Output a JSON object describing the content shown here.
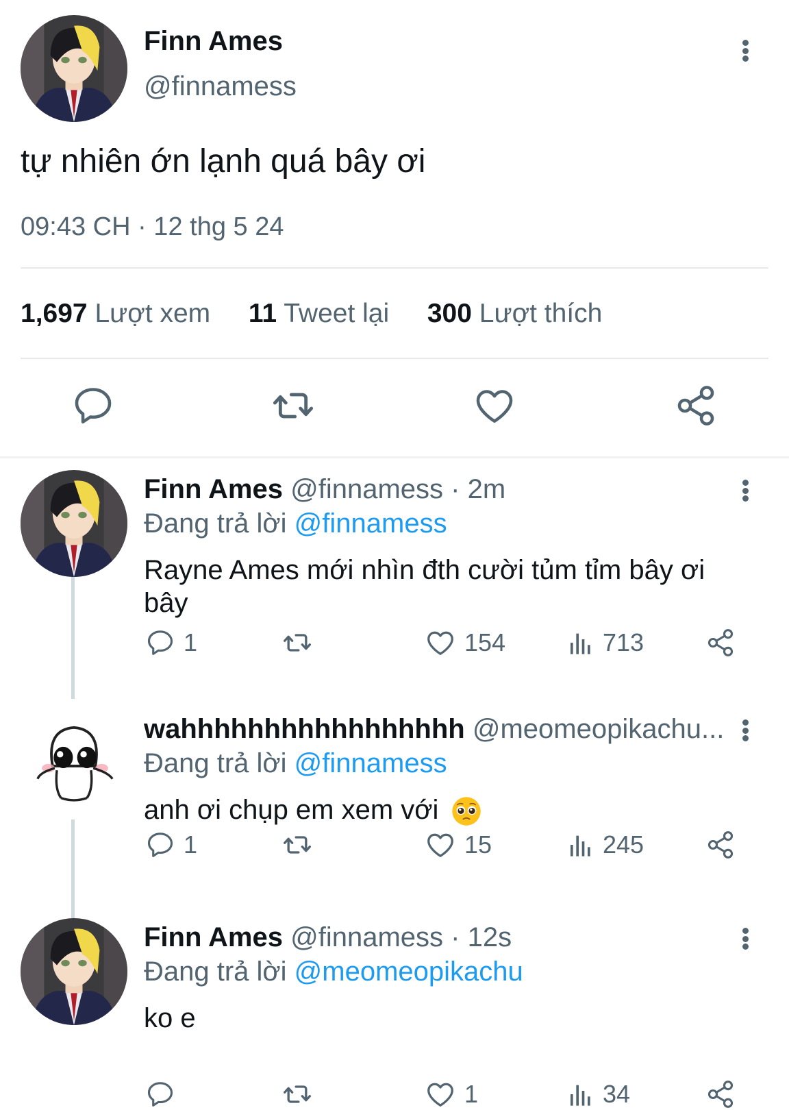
{
  "main_tweet": {
    "author_name": "Finn Ames",
    "author_handle": "@finnamess",
    "text": "tự nhiên ớn lạnh quá bây ơi",
    "timestamp": "09:43 CH · 12 thg 5 24",
    "stats": {
      "views_count": "1,697",
      "views_label": "Lượt xem",
      "retweets_count": "11",
      "retweets_label": "Tweet lại",
      "likes_count": "300",
      "likes_label": "Lượt thích"
    }
  },
  "replies": [
    {
      "author_name": "Finn Ames",
      "author_handle": "@finnamess",
      "time": "· 2m",
      "replying_prefix": "Đang trả lời",
      "replying_to": "@finnamess",
      "text": "Rayne Ames mới nhìn đth cười tủm tỉm bây ơi bây",
      "reply_count": "1",
      "like_count": "154",
      "view_count": "713"
    },
    {
      "author_name": "wahhhhhhhhhhhhhhhhh",
      "author_handle": "@meomeopikachu...",
      "replying_prefix": "Đang trả lời",
      "replying_to": "@finnamess",
      "text": "anh ơi chụp em xem với",
      "emoji": "pleading-face-emoji",
      "reply_count": "1",
      "like_count": "15",
      "view_count": "245"
    },
    {
      "author_name": "Finn Ames",
      "author_handle": "@finnamess",
      "time": "· 12s",
      "replying_prefix": "Đang trả lời",
      "replying_to": "@meomeopikachu",
      "text": "ko e",
      "reply_count": "",
      "like_count": "1",
      "view_count": "34"
    }
  ],
  "colors": {
    "text_primary": "#0f1419",
    "text_secondary": "#536471",
    "mention_blue": "#1d9bf0",
    "divider": "#e6e8ea",
    "thread_line": "#cfd9de"
  },
  "icons": [
    "more-icon",
    "reply-icon",
    "retweet-icon",
    "like-icon",
    "share-icon",
    "views-icon"
  ]
}
